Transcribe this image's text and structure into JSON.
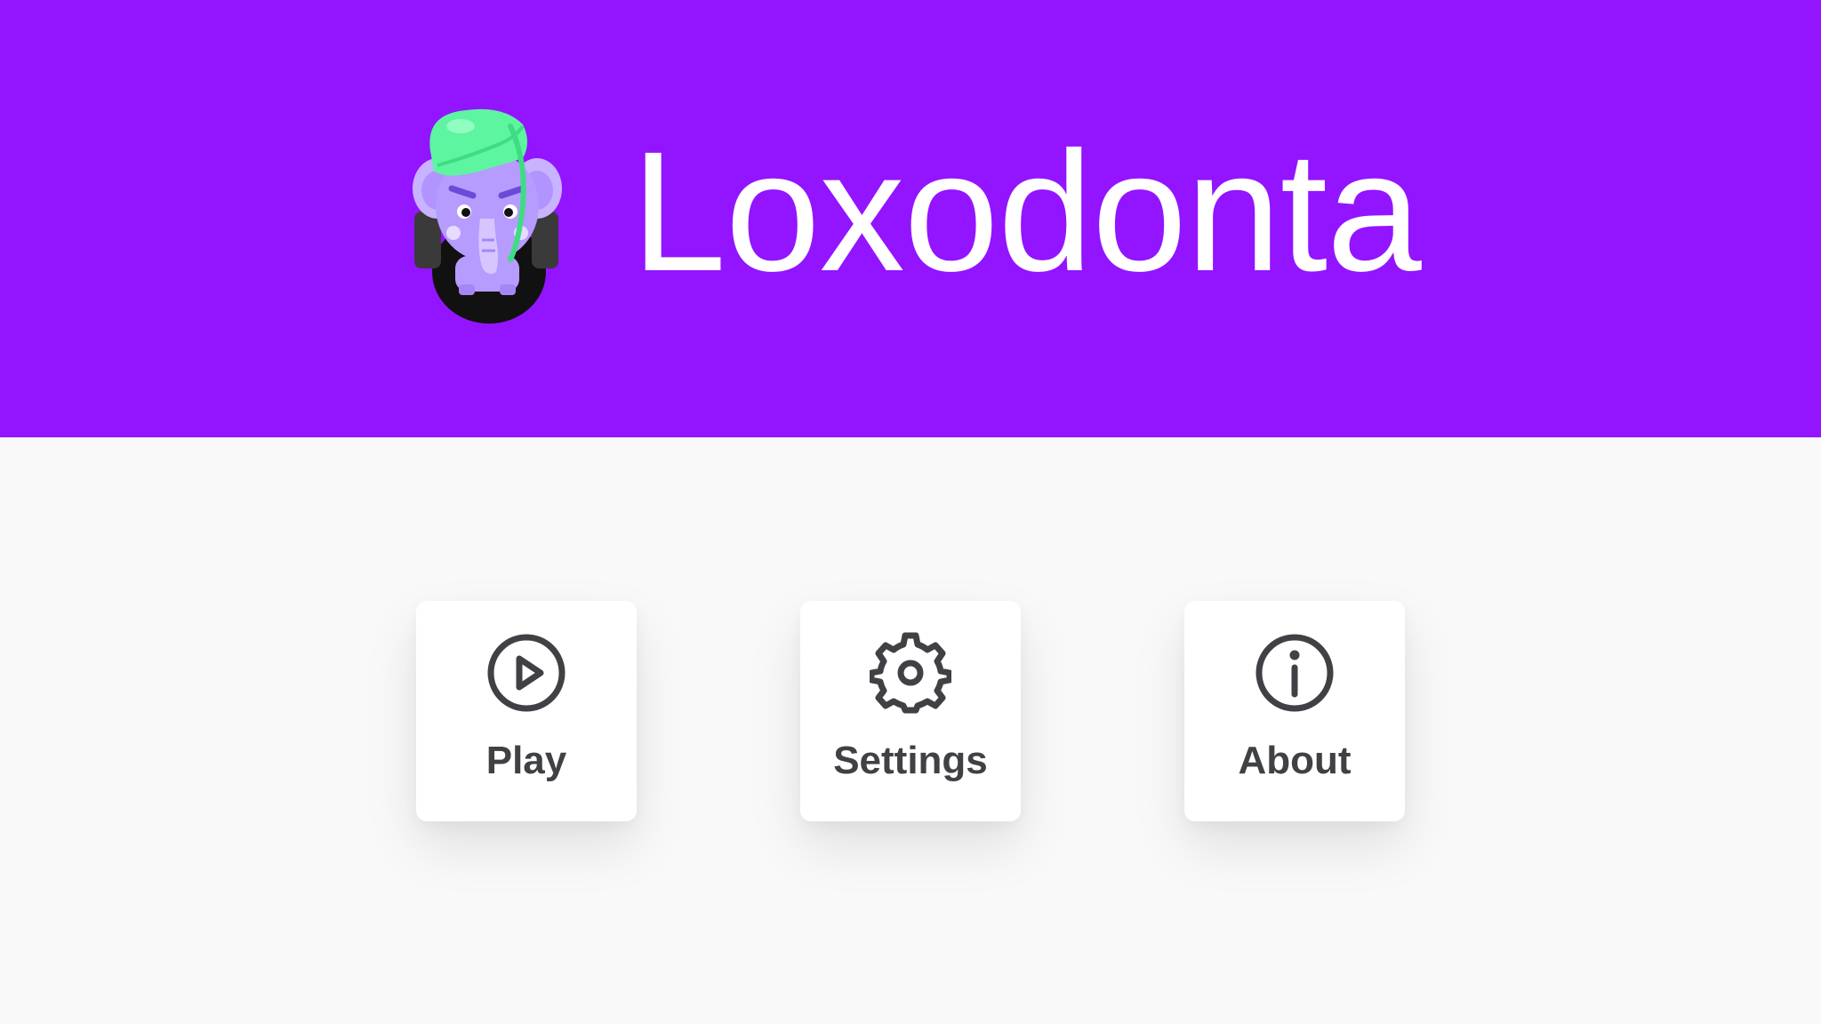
{
  "header": {
    "title": "Loxodonta",
    "background_color": "#9314ff",
    "logo_icon": "elephant-mascot-icon"
  },
  "menu": {
    "items": [
      {
        "id": "play",
        "label": "Play",
        "icon": "play-circle-icon"
      },
      {
        "id": "settings",
        "label": "Settings",
        "icon": "gear-icon"
      },
      {
        "id": "about",
        "label": "About",
        "icon": "info-circle-icon"
      }
    ]
  },
  "colors": {
    "accent": "#9314ff",
    "page_background": "#f9f9f9",
    "card_background": "#ffffff",
    "text_dark": "#3f4144",
    "leaf_green": "#5ef5a0",
    "elephant_lavender": "#b79cff"
  }
}
